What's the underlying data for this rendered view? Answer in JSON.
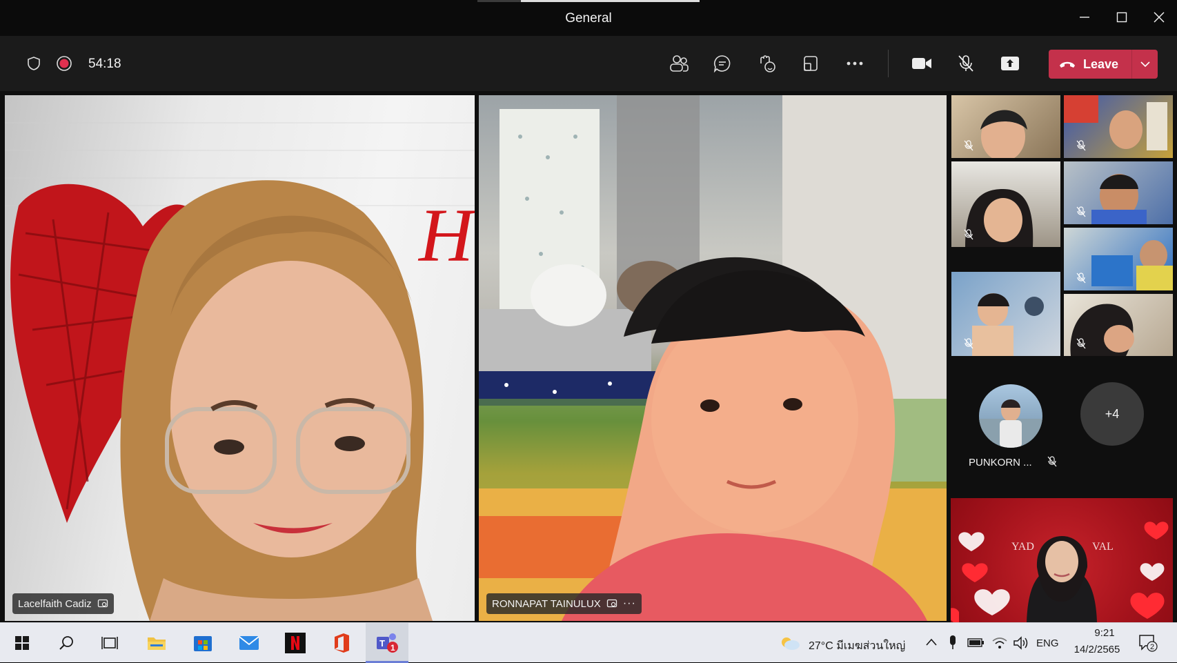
{
  "window": {
    "title": "General",
    "controls": {
      "minimize": "minimize-icon",
      "maximize": "maximize-icon",
      "close": "close-icon"
    }
  },
  "toolbar": {
    "timer": "54:18",
    "leave_label": "Leave",
    "icons": [
      "shield-icon",
      "recording-icon",
      "people-icon",
      "chat-icon",
      "reactions-icon",
      "rooms-icon",
      "more-icon",
      "camera-icon",
      "mic-muted-icon",
      "share-icon"
    ]
  },
  "participants": {
    "main_left": {
      "name": "Lacelfaith Cadiz"
    },
    "main_center": {
      "name": "RONNAPAT TAINULUX",
      "more": "···"
    },
    "overflow_person": {
      "name": "PUNKORN ..."
    },
    "overflow_count": "+4"
  },
  "taskbar": {
    "weather": "27°C มีเมฆส่วนใหญ่",
    "language": "ENG",
    "time": "9:21",
    "date": "14/2/2565",
    "notifications": "2",
    "apps": [
      "start-icon",
      "search-icon",
      "task-view-icon",
      "file-explorer-icon",
      "store-icon",
      "mail-icon",
      "netflix-icon",
      "office-icon",
      "teams-icon"
    ],
    "teams_badge": "1"
  },
  "colors": {
    "leave": "#c4314b",
    "record": "#e0304f",
    "titlebar": "#0b0b0b",
    "toolbar": "#1b1b1b"
  }
}
